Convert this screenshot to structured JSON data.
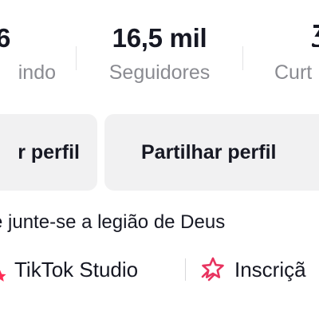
{
  "stats": {
    "following": {
      "count": "6",
      "label": "indo"
    },
    "followers": {
      "count": "16,5 mil",
      "label": "Seguidores"
    },
    "likes": {
      "count": "",
      "label": "Curt"
    }
  },
  "buttons": {
    "edit_profile": "r perfil",
    "share_profile": "Partilhar perfil"
  },
  "bio": "a e junte-se a legião de Deus",
  "links": {
    "studio": "TikTok Studio",
    "subscriptions": "Inscriçã"
  },
  "colors": {
    "accent": "#fe2c55",
    "text": "#161823",
    "muted": "#8a8b91",
    "button_bg": "#f1f1f2"
  },
  "icons": {
    "studio": "star-icon",
    "subscriptions": "subscription-star-icon"
  }
}
